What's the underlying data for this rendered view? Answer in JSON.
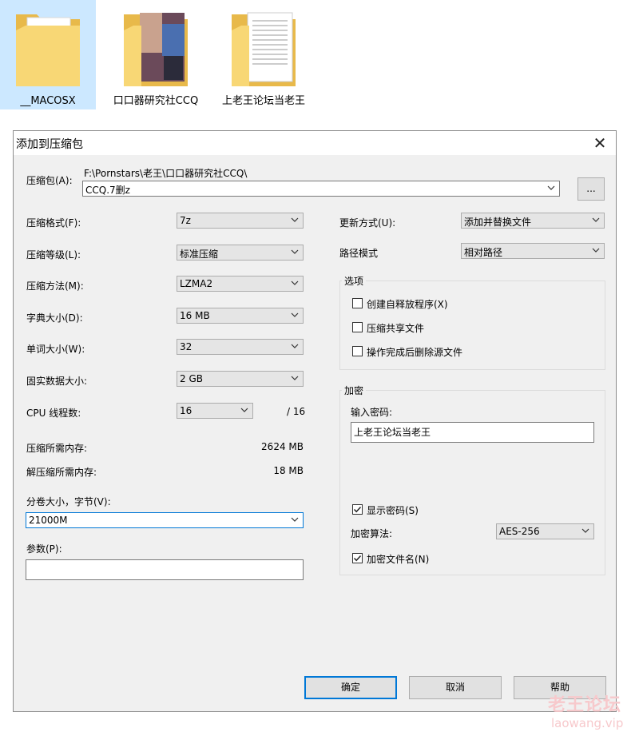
{
  "desktop": {
    "folders": [
      {
        "label": "__MACOSX",
        "selected": true
      },
      {
        "label": "口口器研究社CCQ",
        "selected": false
      },
      {
        "label": "上老王论坛当老王",
        "selected": false
      }
    ]
  },
  "dialog": {
    "title": "添加到压缩包",
    "archive": {
      "label": "压缩包(A):",
      "path": "F:\\Pornstars\\老王\\口口器研究社CCQ\\",
      "name": "CCQ.7删z",
      "browse_label": "..."
    },
    "left_fields": [
      {
        "label": "压缩格式(F):",
        "value": "7z"
      },
      {
        "label": "压缩等级(L):",
        "value": "标准压缩"
      },
      {
        "label": "压缩方法(M):",
        "value": "LZMA2"
      },
      {
        "label": "字典大小(D):",
        "value": "16 MB"
      },
      {
        "label": "单词大小(W):",
        "value": "32"
      },
      {
        "label": "固实数据大小:",
        "value": "2 GB"
      }
    ],
    "cpu": {
      "label": "CPU 线程数:",
      "value": "16",
      "total": "/ 16"
    },
    "mem_compress": {
      "label": "压缩所需内存:",
      "value": "2624 MB"
    },
    "mem_decompress": {
      "label": "解压缩所需内存:",
      "value": "18 MB"
    },
    "volume": {
      "label": "分卷大小，字节(V):",
      "value": "21000M"
    },
    "params": {
      "label": "参数(P):",
      "value": ""
    },
    "update_mode": {
      "label": "更新方式(U):",
      "value": "添加并替换文件"
    },
    "path_mode": {
      "label": "路径模式",
      "value": "相对路径"
    },
    "options": {
      "title": "选项",
      "items": [
        {
          "label": "创建自释放程序(X)",
          "checked": false
        },
        {
          "label": "压缩共享文件",
          "checked": false
        },
        {
          "label": "操作完成后删除源文件",
          "checked": false
        }
      ]
    },
    "encryption": {
      "title": "加密",
      "password_label": "输入密码:",
      "password_value": "上老王论坛当老王",
      "show_password": {
        "label": "显示密码(S)",
        "checked": true
      },
      "method_label": "加密算法:",
      "method_value": "AES-256",
      "encrypt_names": {
        "label": "加密文件名(N)",
        "checked": true
      }
    },
    "buttons": {
      "ok": "确定",
      "cancel": "取消",
      "help": "帮助"
    }
  },
  "watermark": {
    "cn": "老王论坛",
    "en": "laowang.vip"
  },
  "colors": {
    "selection": "#cce8ff",
    "accent": "#0078d7",
    "folder": "#f8d775",
    "dialog_bg": "#f0f0f0"
  }
}
